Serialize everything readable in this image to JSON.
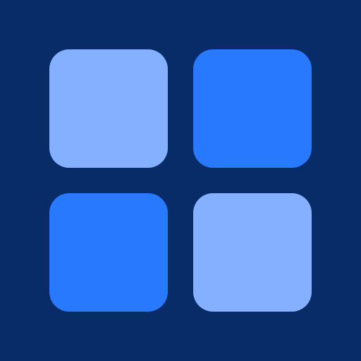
{
  "icon": {
    "name": "app-grid-icon",
    "background_color": "#072c68",
    "tiles": [
      {
        "id": "tile-top-left",
        "color": "#84b0ff"
      },
      {
        "id": "tile-top-right",
        "color": "#2979ff"
      },
      {
        "id": "tile-bottom-left",
        "color": "#2979ff"
      },
      {
        "id": "tile-bottom-right",
        "color": "#84b0ff"
      }
    ]
  }
}
